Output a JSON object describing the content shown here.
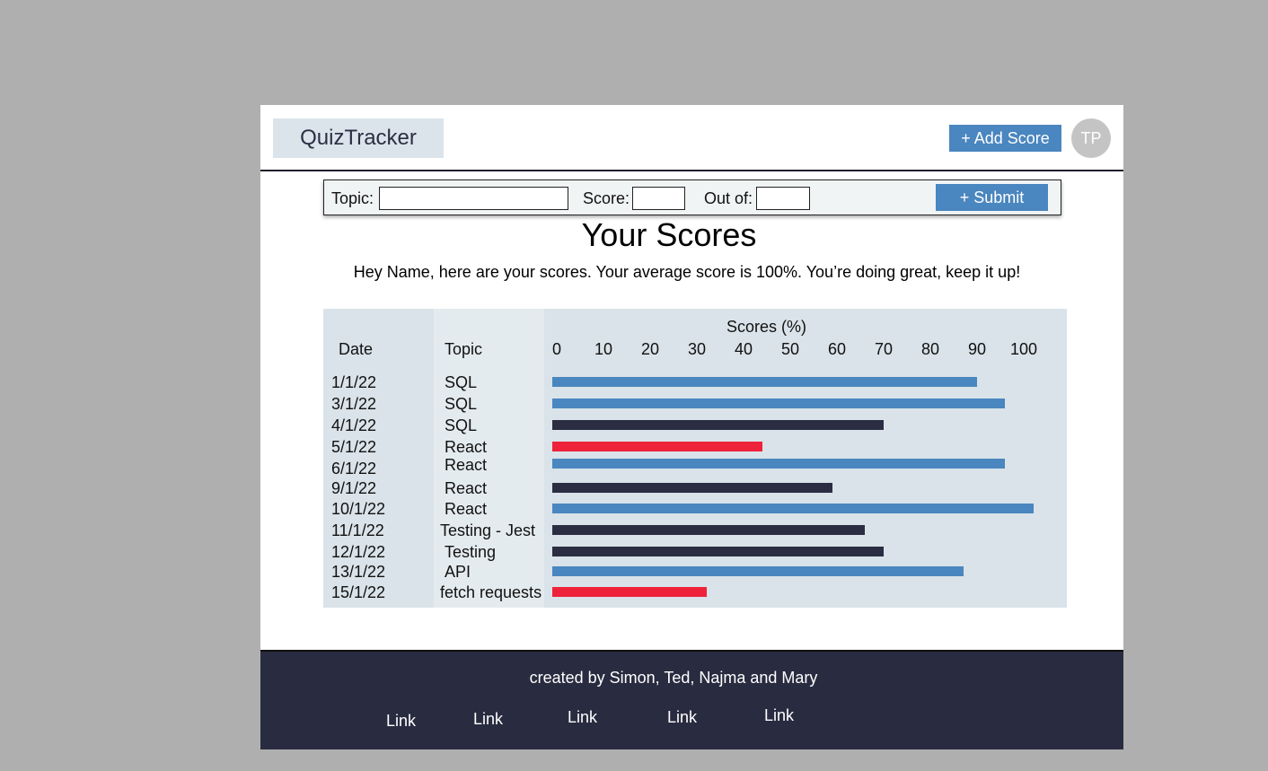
{
  "app": {
    "brand": "QuizTracker"
  },
  "header": {
    "add_score_label": "+ Add Score",
    "avatar_initials": "TP"
  },
  "form": {
    "topic_label": "Topic:",
    "topic_value": "",
    "score_label": "Score:",
    "score_value": "",
    "outof_label": "Out of:",
    "outof_value": "",
    "submit_label": "+ Submit"
  },
  "main": {
    "title": "Your Scores",
    "subtitle": "Hey Name, here are your scores. Your average score is 100%. You’re doing great, keep it up!"
  },
  "table": {
    "date_header": "Date",
    "topic_header": "Topic"
  },
  "chart_data": {
    "type": "bar",
    "orientation": "horizontal",
    "title": "Scores (%)",
    "xlim": [
      0,
      100
    ],
    "ticks": [
      0,
      10,
      20,
      30,
      40,
      50,
      60,
      70,
      80,
      90,
      100
    ],
    "rows": [
      {
        "date": "1/1/22",
        "topic": "SQL",
        "value": 91,
        "color": "#4a86bf"
      },
      {
        "date": "3/1/22",
        "topic": "SQL",
        "value": 97,
        "color": "#4a86bf"
      },
      {
        "date": "4/1/22",
        "topic": "SQL",
        "value": 71,
        "color": "#2b2d42"
      },
      {
        "date": "5/1/22",
        "topic": "React",
        "value": 45,
        "color": "#ee223b"
      },
      {
        "date": "6/1/22",
        "topic": "React",
        "value": 97,
        "color": "#4a86bf"
      },
      {
        "date": "9/1/22",
        "topic": "React",
        "value": 60,
        "color": "#2b2d42"
      },
      {
        "date": "10/1/22",
        "topic": "React",
        "value": 103,
        "color": "#4a86bf"
      },
      {
        "date": "11/1/22",
        "topic": "Testing - Jest",
        "value": 67,
        "color": "#2b2d42"
      },
      {
        "date": "12/1/22",
        "topic": "Testing",
        "value": 71,
        "color": "#2b2d42"
      },
      {
        "date": "13/1/22",
        "topic": "API",
        "value": 88,
        "color": "#4a86bf"
      },
      {
        "date": "15/1/22",
        "topic": "fetch requests",
        "value": 33,
        "color": "#ee223b"
      }
    ]
  },
  "footer": {
    "credit": "created by Simon, Ted, Najma and Mary",
    "links": [
      "Link",
      "Link",
      "Link",
      "Link",
      "Link"
    ]
  }
}
